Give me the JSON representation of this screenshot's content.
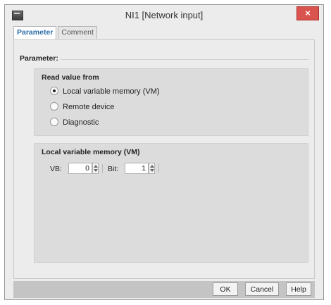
{
  "window": {
    "title": "NI1 [Network input]",
    "close_glyph": "×"
  },
  "tabs": [
    {
      "label": "Parameter",
      "active": true
    },
    {
      "label": "Comment",
      "active": false
    }
  ],
  "section": {
    "title": "Parameter:"
  },
  "read_value_group": {
    "title": "Read value from",
    "options": [
      {
        "label": "Local variable memory (VM)",
        "selected": true
      },
      {
        "label": "Remote device",
        "selected": false
      },
      {
        "label": "Diagnostic",
        "selected": false
      }
    ]
  },
  "vm_group": {
    "title": "Local variable memory (VM)",
    "vb_label": "VB:",
    "vb_value": "0",
    "bit_label": "Bit:",
    "bit_value": "1"
  },
  "buttons": {
    "ok": "OK",
    "cancel": "Cancel",
    "help": "Help"
  },
  "icons": [
    "app-icon",
    "close-icon",
    "radio-icon",
    "spinner-up-down-icon"
  ]
}
